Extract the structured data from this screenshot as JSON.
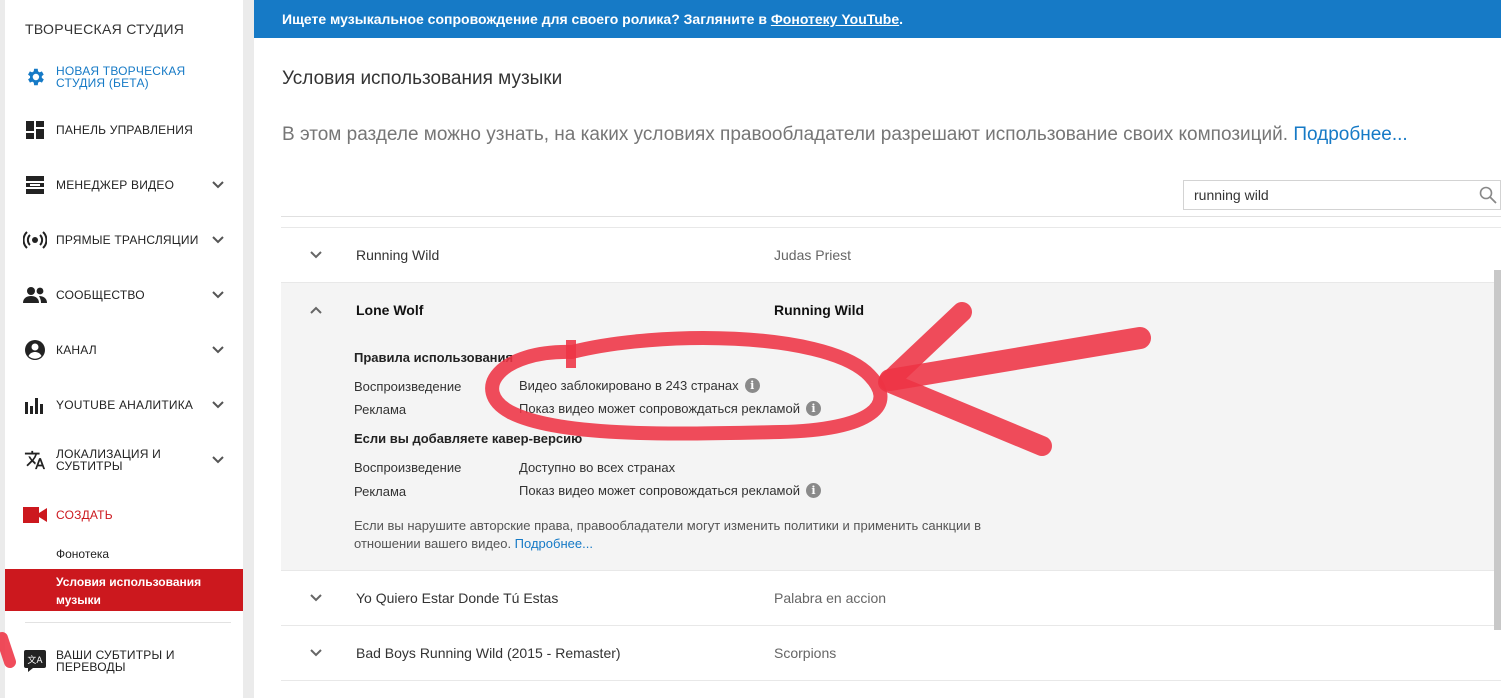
{
  "sidebar": {
    "title": "ТВОРЧЕСКАЯ СТУДИЯ",
    "items": [
      {
        "label": "НОВАЯ ТВОРЧЕСКАЯ СТУДИЯ (БЕТА)",
        "line1": "НОВАЯ ТВОРЧЕСКАЯ",
        "line2": "СТУДИЯ (БЕТА)",
        "icon": "gear-icon"
      },
      {
        "label": "ПАНЕЛЬ УПРАВЛЕНИЯ",
        "icon": "dashboard-icon"
      },
      {
        "label": "МЕНЕДЖЕР ВИДЕО",
        "icon": "video-manager-icon"
      },
      {
        "label": "ПРЯМЫЕ ТРАНСЛЯЦИИ",
        "icon": "live-icon"
      },
      {
        "label": "СООБЩЕСТВО",
        "icon": "community-icon"
      },
      {
        "label": "КАНАЛ",
        "icon": "channel-icon"
      },
      {
        "label": "YOUTUBE АНАЛИТИКА",
        "icon": "analytics-icon"
      },
      {
        "label": "ЛОКАЛИЗАЦИЯ И СУБТИТРЫ",
        "line1": "ЛОКАЛИЗАЦИЯ И",
        "line2": "СУБТИТРЫ",
        "icon": "translate-icon"
      },
      {
        "label": "СОЗДАТЬ",
        "icon": "camera-icon"
      },
      {
        "label": "ВАШИ СУБТИТРЫ И ПЕРЕВОДЫ",
        "line1": "ВАШИ СУБТИТРЫ И",
        "line2": "ПЕРЕВОДЫ",
        "icon": "subtitles-icon"
      }
    ],
    "sub_items": [
      {
        "label": "Фонотека"
      },
      {
        "label": "Условия использования музыки",
        "line1": "Условия использования",
        "line2": "музыки"
      }
    ]
  },
  "banner": {
    "text": "Ищете музыкальное сопровождение для своего ролика? Загляните в ",
    "link": "Фонотеку YouTube",
    "end": "."
  },
  "page": {
    "title": "Условия использования музыки",
    "description": "В этом разделе можно узнать, на каких условиях правообладатели разрешают использование своих композиций. ",
    "more_link": "Подробнее..."
  },
  "search": {
    "value": "running wild"
  },
  "rows": [
    {
      "title": "Running Wild",
      "artist": "Judas Priest"
    },
    {
      "title": "Lone Wolf",
      "artist": "Running Wild"
    },
    {
      "title": "Yo Quiero Estar Donde Tú Estas",
      "artist": "Palabra en accion"
    },
    {
      "title": "Bad Boys Running Wild (2015 - Remaster)",
      "artist": "Scorpions"
    }
  ],
  "details": {
    "rules_heading": "Правила использования",
    "playback_label": "Воспроизведение",
    "ads_label": "Реклама",
    "playback_value": "Видео заблокировано в 243 странах",
    "ads_value": "Показ видео может сопровождаться рекламой",
    "cover_heading": "Если вы добавляете кавер-версию",
    "cover_playback_label": "Воспроизведение",
    "cover_ads_label": "Реклама",
    "cover_playback_value": "Доступно во всех странах",
    "cover_ads_value": "Показ видео может сопровождаться рекламой",
    "note": "Если вы нарушите авторские права, правообладатели могут изменить политики и применить санкции в отношении вашего видео. ",
    "note_link": "Подробнее...",
    "info_glyph": "i"
  },
  "colors": {
    "accent": "#167ac6",
    "red": "#cc181e",
    "annotation": "#ee3344"
  }
}
